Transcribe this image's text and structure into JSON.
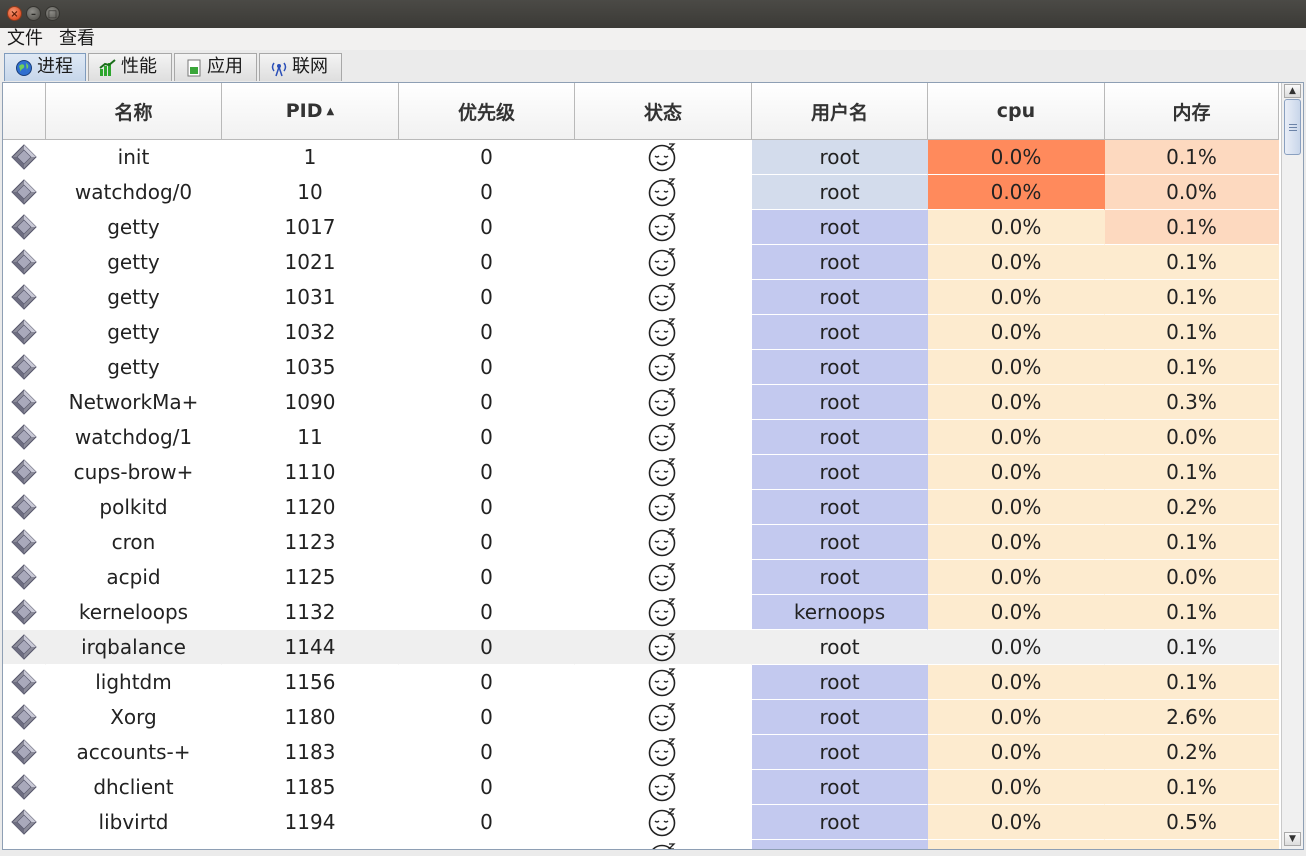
{
  "window": {
    "close_glyph": "×",
    "min_glyph": "–",
    "max_glyph": "□"
  },
  "menu": {
    "file": "文件",
    "view": "查看"
  },
  "tabs": [
    {
      "label": "进程",
      "icon": "globe-icon",
      "active": true
    },
    {
      "label": "性能",
      "icon": "performance-chart-icon",
      "active": false
    },
    {
      "label": "应用",
      "icon": "application-icon",
      "active": false
    },
    {
      "label": "联网",
      "icon": "network-antenna-icon",
      "active": false
    }
  ],
  "columns": {
    "icon": "",
    "name": "名称",
    "pid": "PID",
    "priority": "优先级",
    "state": "状态",
    "user": "用户名",
    "cpu": "cpu",
    "mem": "内存"
  },
  "sort": {
    "column": "pid",
    "direction": "ascending",
    "arrow": "▲"
  },
  "colors": {
    "cpu_hot": "#ff8a5c",
    "mem_warm": "#fdd9bf",
    "normal_bg": "#fdebcf",
    "user_root_highlight": "#d3dcec",
    "user_bg": "#c3c9ef",
    "selected_row": "#efefef"
  },
  "processes": [
    {
      "name": "init",
      "pid": "1",
      "priority": "0",
      "user": "root",
      "cpu": "0.0%",
      "mem": "0.1%",
      "cpu_level": "hot",
      "mem_level": "warm",
      "user_level": "light"
    },
    {
      "name": "watchdog/0",
      "pid": "10",
      "priority": "0",
      "user": "root",
      "cpu": "0.0%",
      "mem": "0.0%",
      "cpu_level": "hot",
      "mem_level": "warm",
      "user_level": "light"
    },
    {
      "name": "getty",
      "pid": "1017",
      "priority": "0",
      "user": "root",
      "cpu": "0.0%",
      "mem": "0.1%",
      "cpu_level": "normal",
      "mem_level": "warm",
      "user_level": "normal"
    },
    {
      "name": "getty",
      "pid": "1021",
      "priority": "0",
      "user": "root",
      "cpu": "0.0%",
      "mem": "0.1%",
      "cpu_level": "normal",
      "mem_level": "normal",
      "user_level": "normal"
    },
    {
      "name": "getty",
      "pid": "1031",
      "priority": "0",
      "user": "root",
      "cpu": "0.0%",
      "mem": "0.1%",
      "cpu_level": "normal",
      "mem_level": "normal",
      "user_level": "normal"
    },
    {
      "name": "getty",
      "pid": "1032",
      "priority": "0",
      "user": "root",
      "cpu": "0.0%",
      "mem": "0.1%",
      "cpu_level": "normal",
      "mem_level": "normal",
      "user_level": "normal"
    },
    {
      "name": "getty",
      "pid": "1035",
      "priority": "0",
      "user": "root",
      "cpu": "0.0%",
      "mem": "0.1%",
      "cpu_level": "normal",
      "mem_level": "normal",
      "user_level": "normal"
    },
    {
      "name": "NetworkMa+",
      "pid": "1090",
      "priority": "0",
      "user": "root",
      "cpu": "0.0%",
      "mem": "0.3%",
      "cpu_level": "normal",
      "mem_level": "normal",
      "user_level": "normal"
    },
    {
      "name": "watchdog/1",
      "pid": "11",
      "priority": "0",
      "user": "root",
      "cpu": "0.0%",
      "mem": "0.0%",
      "cpu_level": "normal",
      "mem_level": "normal",
      "user_level": "normal"
    },
    {
      "name": "cups-brow+",
      "pid": "1110",
      "priority": "0",
      "user": "root",
      "cpu": "0.0%",
      "mem": "0.1%",
      "cpu_level": "normal",
      "mem_level": "normal",
      "user_level": "normal"
    },
    {
      "name": "polkitd",
      "pid": "1120",
      "priority": "0",
      "user": "root",
      "cpu": "0.0%",
      "mem": "0.2%",
      "cpu_level": "normal",
      "mem_level": "normal",
      "user_level": "normal"
    },
    {
      "name": "cron",
      "pid": "1123",
      "priority": "0",
      "user": "root",
      "cpu": "0.0%",
      "mem": "0.1%",
      "cpu_level": "normal",
      "mem_level": "normal",
      "user_level": "normal"
    },
    {
      "name": "acpid",
      "pid": "1125",
      "priority": "0",
      "user": "root",
      "cpu": "0.0%",
      "mem": "0.0%",
      "cpu_level": "normal",
      "mem_level": "normal",
      "user_level": "normal"
    },
    {
      "name": "kerneloops",
      "pid": "1132",
      "priority": "0",
      "user": "kernoops",
      "cpu": "0.0%",
      "mem": "0.1%",
      "cpu_level": "normal",
      "mem_level": "normal",
      "user_level": "normal"
    },
    {
      "name": "irqbalance",
      "pid": "1144",
      "priority": "0",
      "user": "root",
      "cpu": "0.0%",
      "mem": "0.1%",
      "cpu_level": "normal",
      "mem_level": "normal",
      "user_level": "normal",
      "selected": true
    },
    {
      "name": "lightdm",
      "pid": "1156",
      "priority": "0",
      "user": "root",
      "cpu": "0.0%",
      "mem": "0.1%",
      "cpu_level": "normal",
      "mem_level": "normal",
      "user_level": "normal"
    },
    {
      "name": "Xorg",
      "pid": "1180",
      "priority": "0",
      "user": "root",
      "cpu": "0.0%",
      "mem": "2.6%",
      "cpu_level": "normal",
      "mem_level": "normal",
      "user_level": "normal"
    },
    {
      "name": "accounts-+",
      "pid": "1183",
      "priority": "0",
      "user": "root",
      "cpu": "0.0%",
      "mem": "0.2%",
      "cpu_level": "normal",
      "mem_level": "normal",
      "user_level": "normal"
    },
    {
      "name": "dhclient",
      "pid": "1185",
      "priority": "0",
      "user": "root",
      "cpu": "0.0%",
      "mem": "0.1%",
      "cpu_level": "normal",
      "mem_level": "normal",
      "user_level": "normal"
    },
    {
      "name": "libvirtd",
      "pid": "1194",
      "priority": "0",
      "user": "root",
      "cpu": "0.0%",
      "mem": "0.5%",
      "cpu_level": "normal",
      "mem_level": "normal",
      "user_level": "normal"
    },
    {
      "name": "",
      "pid": "",
      "priority": "",
      "user": "",
      "cpu": "",
      "mem": "",
      "cpu_level": "normal",
      "mem_level": "normal",
      "user_level": "normal"
    }
  ],
  "row_icons": {
    "process": "process-gem-icon",
    "state": "sleeping-face-icon"
  },
  "scrollbar": {
    "up": "▲",
    "down": "▼"
  }
}
